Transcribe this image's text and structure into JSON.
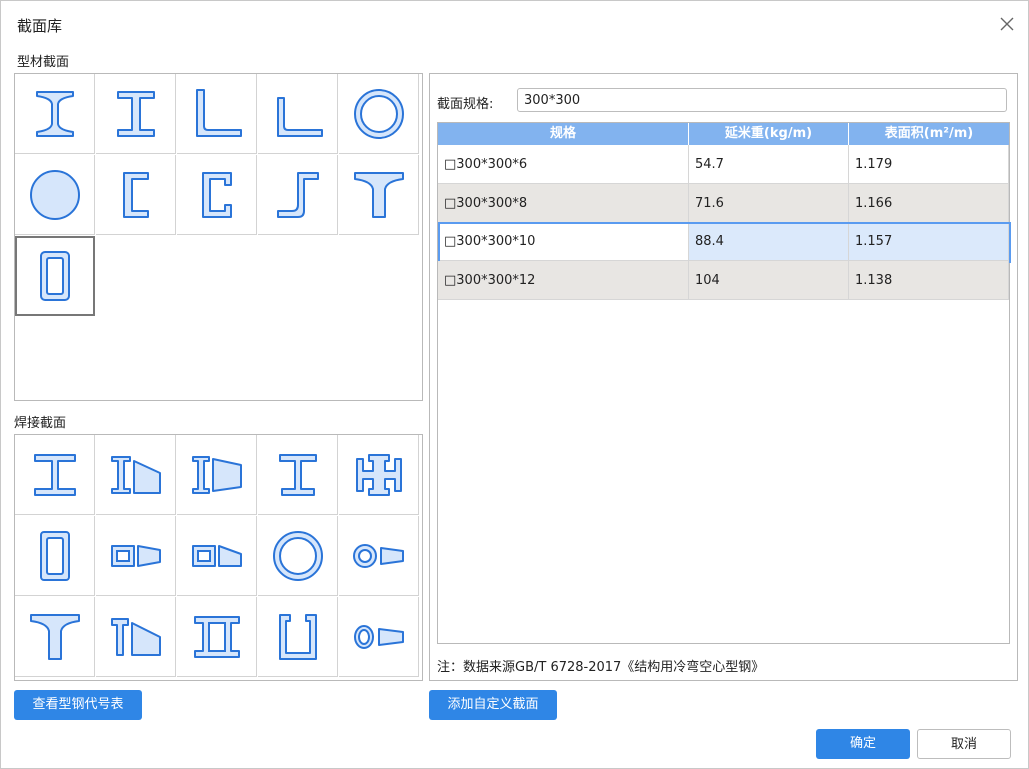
{
  "window": {
    "title": "截面库",
    "close_icon": "close-icon"
  },
  "profile_section": {
    "label": "型材截面",
    "items": [
      "i-beam",
      "h-beam",
      "equal-angle",
      "unequal-angle",
      "circular-tube",
      "round-bar",
      "channel",
      "lipped-channel",
      "z-section",
      "t-section",
      "rectangular-tube"
    ],
    "selected": "rectangular-tube"
  },
  "welded_section": {
    "label": "焊接截面",
    "items": [
      "welded-i",
      "welded-tapered-i",
      "welded-tapered-i-2",
      "welded-unequal-i",
      "welded-cross",
      "welded-box",
      "welded-tapered-box",
      "welded-tapered-box-2",
      "welded-pipe",
      "welded-tapered-pipe",
      "welded-t",
      "welded-tapered-t",
      "welded-double-i",
      "welded-u",
      "welded-tapered-pipe-2"
    ]
  },
  "spec": {
    "label": "截面规格:",
    "value": "300*300"
  },
  "table": {
    "headers": [
      "规格",
      "延米重(kg/m)",
      "表面积(m²/m)"
    ],
    "rows": [
      [
        "□300*300*6",
        "54.7",
        "1.179"
      ],
      [
        "□300*300*8",
        "71.6",
        "1.166"
      ],
      [
        "□300*300*10",
        "88.4",
        "1.157"
      ],
      [
        "□300*300*12",
        "104",
        "1.138"
      ]
    ],
    "selected_row": 2
  },
  "note": "注：数据来源GB/T 6728-2017《结构用冷弯空心型钢》",
  "buttons": {
    "view_code_table": "查看型钢代号表",
    "add_custom": "添加自定义截面",
    "ok": "确定",
    "cancel": "取消"
  },
  "colors": {
    "accent": "#2f86e6",
    "header": "#82b3ef",
    "shape_fill": "#d6e6fb",
    "shape_stroke": "#2a74d8"
  }
}
